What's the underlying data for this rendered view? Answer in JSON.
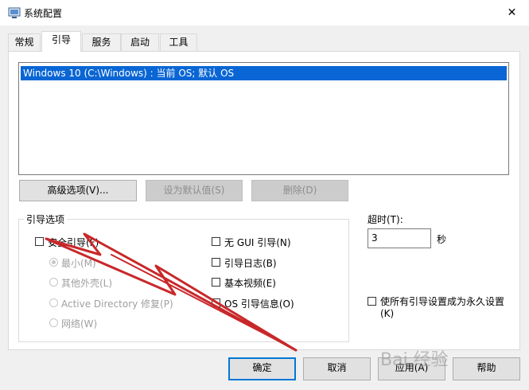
{
  "window": {
    "title": "系统配置",
    "close_glyph": "✕"
  },
  "tabs": [
    {
      "label": "常规",
      "active": false
    },
    {
      "label": "引导",
      "active": true
    },
    {
      "label": "服务",
      "active": false
    },
    {
      "label": "启动",
      "active": false
    },
    {
      "label": "工具",
      "active": false
    }
  ],
  "boot": {
    "os_entries": [
      "Windows 10 (C:\\Windows) : 当前 OS; 默认 OS"
    ],
    "buttons": {
      "advanced": "高级选项(V)...",
      "set_default": "设为默认值(S)",
      "delete": "删除(D)"
    },
    "options_group_label": "引导选项",
    "safe_boot": {
      "label": "安全引导(F)",
      "checked": false
    },
    "safe_modes": [
      {
        "label": "最小(M)",
        "selected": true
      },
      {
        "label": "其他外壳(L)",
        "selected": false
      },
      {
        "label": "Active Directory 修复(P)",
        "selected": false
      },
      {
        "label": "网络(W)",
        "selected": false
      }
    ],
    "right_options": [
      {
        "label": "无 GUI 引导(N)",
        "checked": false
      },
      {
        "label": "引导日志(B)",
        "checked": false
      },
      {
        "label": "基本视频(E)",
        "checked": false
      },
      {
        "label": "OS 引导信息(O)",
        "checked": false
      }
    ],
    "timeout": {
      "label": "超时(T):",
      "value": "3",
      "unit": "秒"
    },
    "permanent": {
      "label_line1": "使所有引导设置成为永久设置",
      "label_line2": "(K)",
      "checked": false
    }
  },
  "footer": {
    "ok": "确定",
    "cancel": "取消",
    "apply": "应用(A)",
    "help": "帮助"
  },
  "annotation": {
    "arrow_color": "#c8282a"
  },
  "watermark": "Bai 经验"
}
